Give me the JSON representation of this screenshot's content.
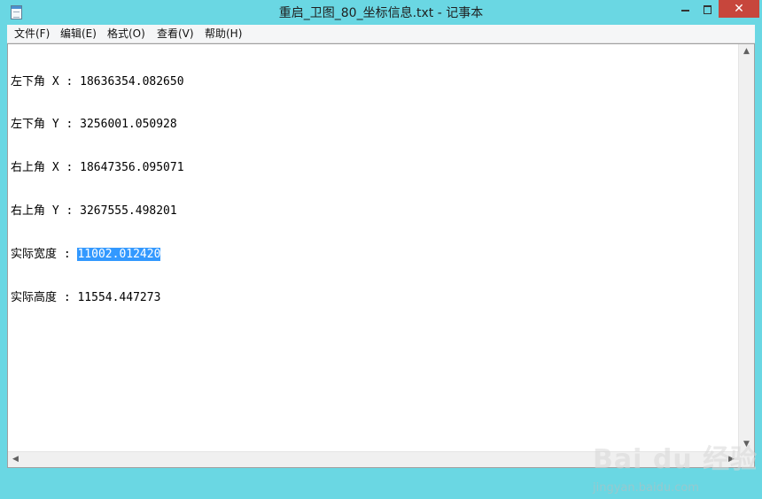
{
  "window": {
    "title": "重启_卫图_80_坐标信息.txt - 记事本",
    "close_glyph": "✕",
    "accent_close": "#c7463c",
    "frame_color": "#6ad7e3"
  },
  "menu": {
    "items": [
      {
        "label": "文件(F)"
      },
      {
        "label": "编辑(E)"
      },
      {
        "label": "格式(O)"
      },
      {
        "label": "查看(V)"
      },
      {
        "label": "帮助(H)"
      }
    ]
  },
  "document": {
    "lines": [
      {
        "text": "左下角 X : 18636354.082650"
      },
      {
        "text": "左下角 Y : 3256001.050928"
      },
      {
        "text": "右上角 X : 18647356.095071"
      },
      {
        "text": "右上角 Y : 3267555.498201"
      },
      {
        "prefix": "实际宽度 : ",
        "selected": "11002.012420"
      },
      {
        "text": "实际高度 : 11554.447273"
      }
    ],
    "selection_color": "#3399ff"
  },
  "scrollbars": {
    "up_glyph": "▲",
    "down_glyph": "▼",
    "left_glyph": "◀",
    "right_glyph": "▶"
  },
  "watermark": {
    "logo": "Bai du 经验",
    "url": "jingyan.baidu.com"
  }
}
